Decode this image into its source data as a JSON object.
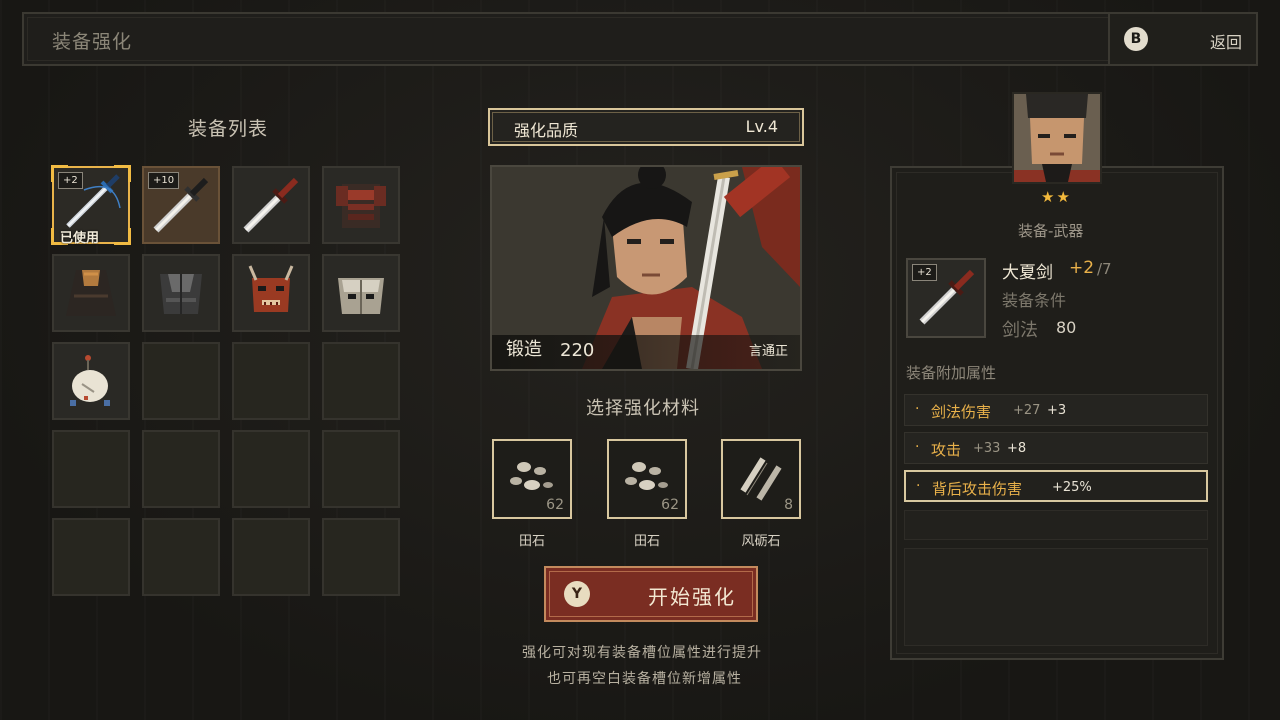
{
  "header": {
    "title": "装备强化",
    "back_key": "B",
    "back_label": "返回"
  },
  "equipment_list": {
    "title": "装备列表",
    "slots": [
      {
        "badge": "+2",
        "status": "已使用",
        "icon": "blue-sword-icon"
      },
      {
        "badge": "+10",
        "icon": "steel-sword-icon"
      },
      {
        "icon": "red-hilt-sword-icon"
      },
      {
        "icon": "red-armor-icon"
      },
      {
        "icon": "dark-robe-icon"
      },
      {
        "icon": "iron-armor-icon"
      },
      {
        "icon": "red-demon-mask-icon"
      },
      {
        "icon": "white-mask-icon"
      },
      {
        "icon": "white-bird-charm-icon"
      }
    ]
  },
  "quality": {
    "label": "强化品质",
    "level": "Lv.4"
  },
  "portrait": {
    "forge_label": "锻造",
    "forge_value": "220",
    "character_name": "言通正"
  },
  "materials": {
    "title": "选择强化材料",
    "items": [
      {
        "name": "田石",
        "count": "62",
        "icon": "field-stone-icon"
      },
      {
        "name": "田石",
        "count": "62",
        "icon": "field-stone-icon"
      },
      {
        "name": "风砺石",
        "count": "8",
        "icon": "wind-whetstone-icon"
      }
    ]
  },
  "start_button": {
    "key": "Y",
    "label": "开始强化"
  },
  "hints": {
    "line1": "强化可对现有装备槽位属性进行提升",
    "line2": "也可再空白装备槽位新增属性"
  },
  "detail": {
    "stars": "★★",
    "category": "装备-武器",
    "item_badge": "+2",
    "item_name": "大夏剑",
    "item_plus": "+2",
    "item_max": "/7",
    "requirement_label": "装备条件",
    "requirement_stat": "剑法",
    "requirement_value": "80",
    "attr_title": "装备附加属性",
    "attributes": [
      {
        "name": "剑法伤害",
        "value": "+27",
        "bonus": "+3"
      },
      {
        "name": "攻击",
        "value": "+33",
        "bonus": "+8"
      },
      {
        "name": "背后攻击伤害",
        "value": "",
        "bonus": "+25%"
      }
    ]
  },
  "colors": {
    "accent_gold": "#e9b14a",
    "button_red": "#7a2d22",
    "frame": "#d8c79f"
  }
}
